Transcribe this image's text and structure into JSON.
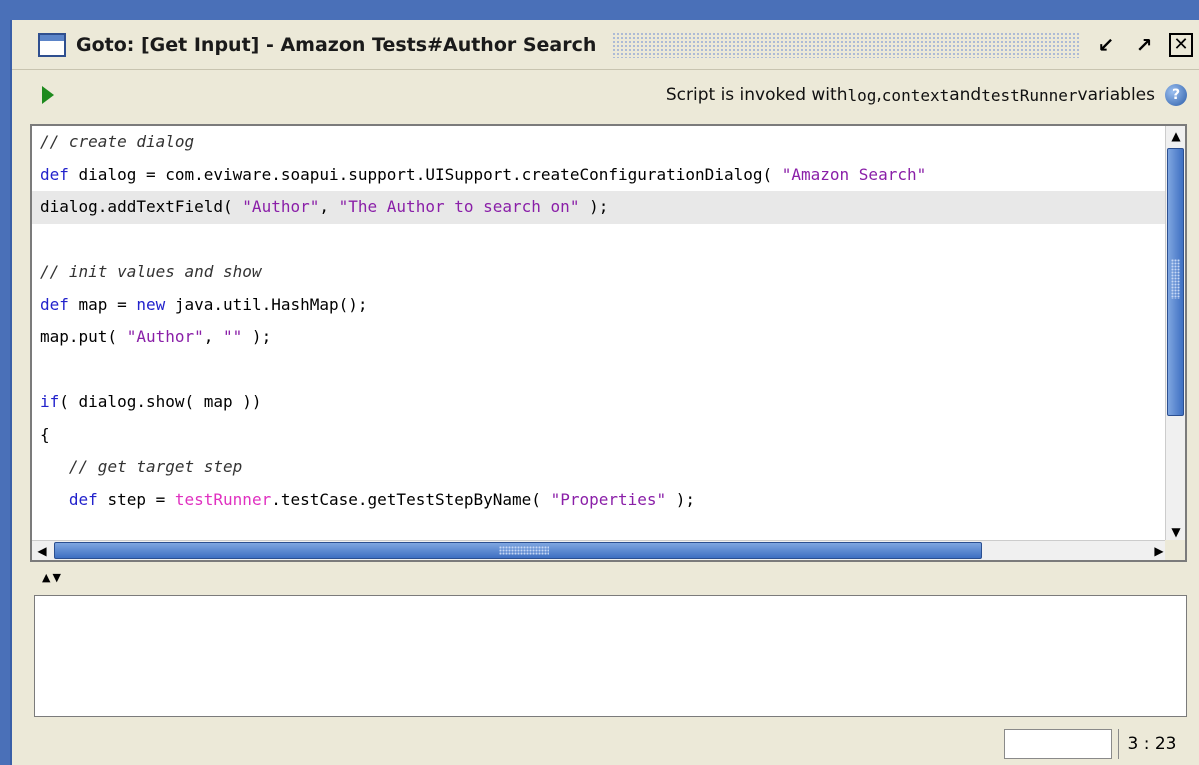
{
  "window": {
    "title": "Goto: [Get Input] - Amazon Tests#Author Search",
    "minimize_glyph": "↙",
    "maximize_glyph": "↗",
    "close_glyph": "✕"
  },
  "toolbar": {
    "info_prefix": "Script is invoked with ",
    "var_log": "log",
    "sep1": ", ",
    "var_context": "context",
    "sep2": " and ",
    "var_testrunner": "testRunner",
    "info_suffix": " variables",
    "help_glyph": "?"
  },
  "editor": {
    "lines": [
      [
        {
          "t": "// create dialog",
          "c": "cm"
        }
      ],
      [
        {
          "t": "def",
          "c": "kw"
        },
        {
          "t": " dialog = com.eviware.soapui.support.UISupport.createConfigurationDialog( "
        },
        {
          "t": "\"Amazon Search\"",
          "c": "st"
        }
      ],
      [
        {
          "t": "dialog.addTextField( "
        },
        {
          "t": "\"Author\"",
          "c": "st"
        },
        {
          "t": ", "
        },
        {
          "t": "\"The Author to search on\"",
          "c": "st"
        },
        {
          "t": " );"
        }
      ],
      [
        {
          "t": ""
        }
      ],
      [
        {
          "t": "// init values and show",
          "c": "cm"
        }
      ],
      [
        {
          "t": "def",
          "c": "kw"
        },
        {
          "t": " map = "
        },
        {
          "t": "new",
          "c": "kw"
        },
        {
          "t": " java.util.HashMap();"
        }
      ],
      [
        {
          "t": "map.put( "
        },
        {
          "t": "\"Author\"",
          "c": "st"
        },
        {
          "t": ", "
        },
        {
          "t": "\"\"",
          "c": "st"
        },
        {
          "t": " );"
        }
      ],
      [
        {
          "t": ""
        }
      ],
      [
        {
          "t": "if",
          "c": "kw"
        },
        {
          "t": "( dialog.show( map ))"
        }
      ],
      [
        {
          "t": "{"
        }
      ],
      [
        {
          "t": "   "
        },
        {
          "t": "// get target step",
          "c": "cm"
        }
      ],
      [
        {
          "t": "   "
        },
        {
          "t": "def",
          "c": "kw"
        },
        {
          "t": " step = "
        },
        {
          "t": "testRunner",
          "c": "gv"
        },
        {
          "t": ".testCase.getTestStepByName( "
        },
        {
          "t": "\"Properties\"",
          "c": "st"
        },
        {
          "t": " );"
        }
      ]
    ],
    "highlighted_line": 2
  },
  "scrollbars": {
    "up_glyph": "▲",
    "down_glyph": "▼",
    "left_glyph": "◀",
    "right_glyph": "▶"
  },
  "splitter": {
    "up_glyph": "▲",
    "down_glyph": "▼"
  },
  "statusbar": {
    "position": "3 : 23"
  },
  "colors": {
    "keyword": "#2222cc",
    "string": "#8a1fa8",
    "global_var": "#e030c0",
    "run_button": "#1e8a1e"
  },
  "icons": {
    "window": "window-icon",
    "run": "play-icon",
    "help": "help-icon"
  }
}
